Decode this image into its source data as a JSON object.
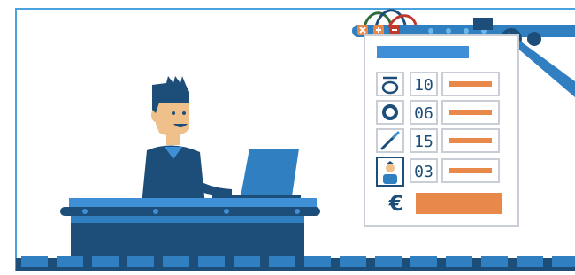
{
  "palette": {
    "frame": "#4aa3df",
    "navy": "#1d4e7a",
    "blue": "#2f7fc1",
    "light_blue": "#3e8fd6",
    "orange": "#e8894b",
    "panel_bg": "#ffffff",
    "panel_border": "#c9ced6",
    "skin": "#f0c08b",
    "hair": "#1d4e7a",
    "gray": "#8f98a3"
  },
  "panel": {
    "items": [
      {
        "icon": "ring-icon",
        "number": "10"
      },
      {
        "icon": "o-ring-icon",
        "number": "06"
      },
      {
        "icon": "tool-icon",
        "number": "15"
      },
      {
        "icon": "worker-photo-icon",
        "number": "03"
      }
    ],
    "total_symbol": "€",
    "top_controls": [
      "close-icon",
      "plus-icon",
      "minus-icon"
    ]
  }
}
